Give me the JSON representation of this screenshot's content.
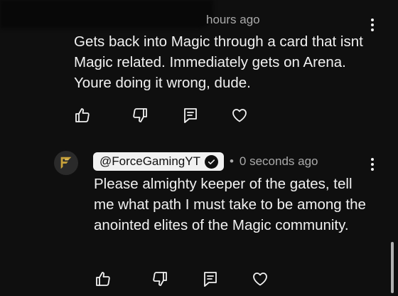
{
  "comment1": {
    "timestamp": "hours ago",
    "text": "Gets back into Magic through a card that isnt Magic related. Immediately gets on Arena. Youre doing it wrong, dude."
  },
  "reply": {
    "author": "@ForceGamingYT",
    "separator": "•",
    "timestamp": "0 seconds ago",
    "text": "Please almighty keeper of the gates, tell me what path I must take to be among the anointed elites of the Magic community."
  },
  "icons": {
    "like": "thumbs-up-icon",
    "dislike": "thumbs-down-icon",
    "reply": "reply-icon",
    "heart": "heart-icon",
    "menu": "more-vertical-icon",
    "avatar": "force-gaming-logo"
  },
  "colors": {
    "background": "#0f0f0f",
    "text": "#f1f1f1",
    "meta": "#aaaaaa",
    "chip": "#f1f1f1",
    "logo": "#c9a23a"
  }
}
